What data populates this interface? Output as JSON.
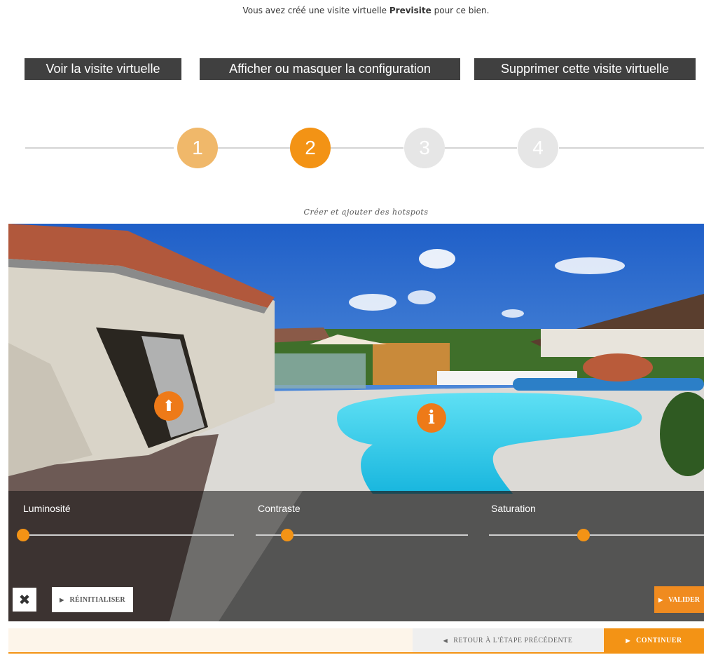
{
  "notice": {
    "prefix": "Vous avez créé une visite virtuelle ",
    "tour_name": "Previsite",
    "suffix": " pour ce bien."
  },
  "actions": {
    "view_label": "Voir la visite virtuelle",
    "config_label": "Afficher ou masquer la configuration",
    "delete_label": "Supprimer cette visite virtuelle"
  },
  "stepper": {
    "steps": [
      "1",
      "2",
      "3",
      "4"
    ],
    "current_step": 2
  },
  "viewer": {
    "caption": "Créer et ajouter des hotspots",
    "hotspots": {
      "arrow_icon": "arrow-up-icon",
      "info_icon": "info-icon",
      "arrow_glyph": "⬆",
      "info_glyph": "i"
    },
    "sliders": [
      {
        "label": "Luminosité",
        "value": 0.0
      },
      {
        "label": "Contraste",
        "value": 0.15
      },
      {
        "label": "Saturation",
        "value": 0.44
      }
    ],
    "close_glyph": "✖",
    "reset_label": "RÉINITIALISER",
    "validate_label": "VALIDER"
  },
  "footer": {
    "back_label": "RETOUR À L'ÉTAPE PRÉCÉDENTE",
    "continue_label": "CONTINUER"
  },
  "colors": {
    "accent": "#f39315",
    "step_done": "#f0b86a",
    "step_todo": "#e6e6e6",
    "dark_button": "#404040"
  }
}
